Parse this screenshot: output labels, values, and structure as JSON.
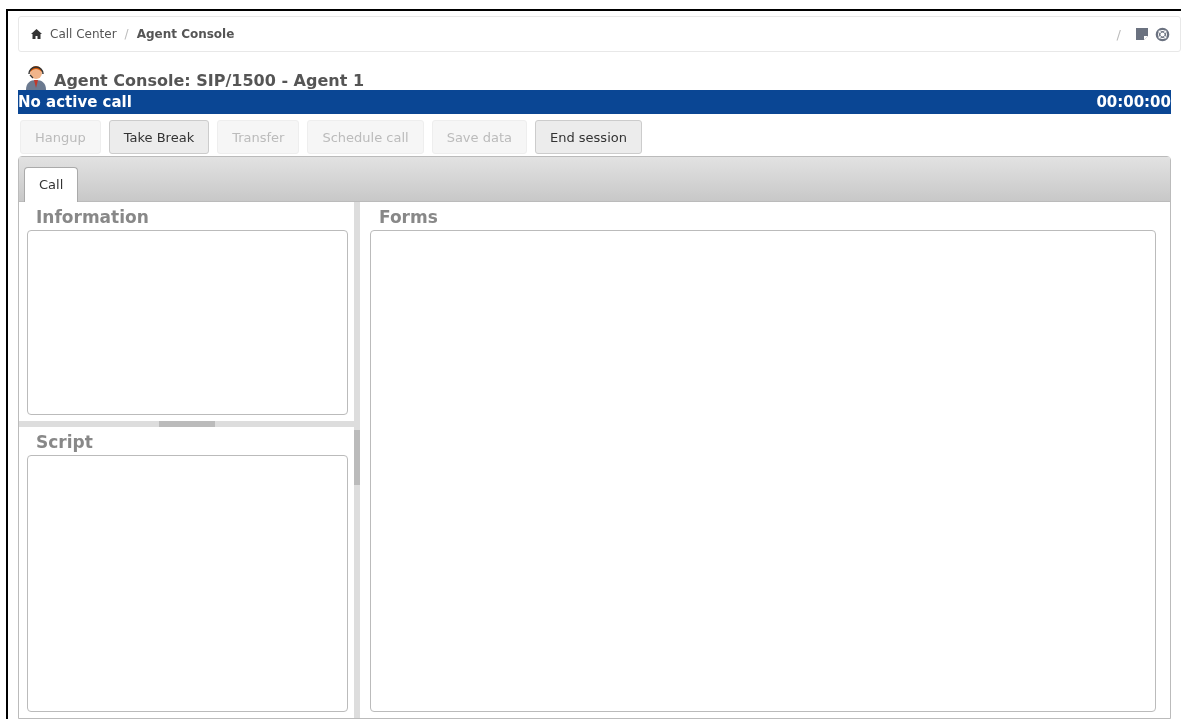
{
  "breadcrumb": {
    "items": [
      {
        "label": "Call Center",
        "current": false
      },
      {
        "label": "Agent Console",
        "current": true
      }
    ],
    "trail_separator": "/"
  },
  "title": "Agent Console: SIP/1500 - Agent 1",
  "status_bar": {
    "text": "No active call",
    "timer": "00:00:00"
  },
  "buttons": [
    {
      "label": "Hangup",
      "disabled": true
    },
    {
      "label": "Take Break",
      "disabled": false
    },
    {
      "label": "Transfer",
      "disabled": true
    },
    {
      "label": "Schedule call",
      "disabled": true
    },
    {
      "label": "Save data",
      "disabled": true
    },
    {
      "label": "End session",
      "disabled": false
    }
  ],
  "tabs": [
    {
      "label": "Call",
      "selected": true
    }
  ],
  "panels": {
    "information": "Information",
    "script": "Script",
    "forms": "Forms"
  }
}
